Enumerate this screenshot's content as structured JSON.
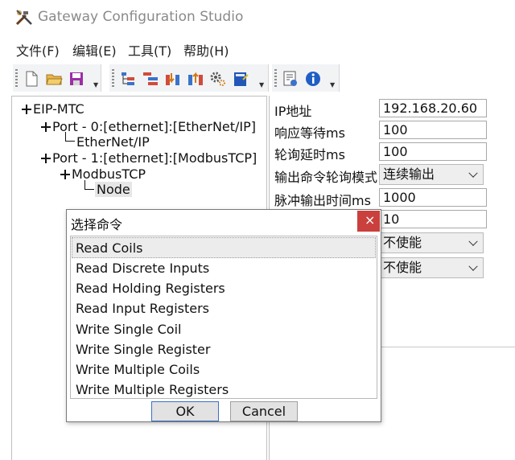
{
  "window": {
    "title": "Gateway Configuration Studio"
  },
  "menu": [
    "文件(F)",
    "编辑(E)",
    "工具(T)",
    "帮助(H)"
  ],
  "toolbar": {
    "groups": [
      [
        "new-file-icon",
        "open-folder-icon",
        "save-icon"
      ],
      [
        "tree-config-icon",
        "list-config-icon",
        "import-icon",
        "export-icon",
        "settings-gear-icon",
        "notebook-icon"
      ],
      [
        "document-settings-icon",
        "info-icon"
      ]
    ]
  },
  "tree": {
    "root": "EIP-MTC",
    "port0": "Port - 0:[ethernet]:[EtherNet/IP]",
    "port0_child": "EtherNet/IP",
    "port1": "Port - 1:[ethernet]:[ModbusTCP]",
    "port1_child": "ModbusTCP",
    "node": "Node"
  },
  "properties": {
    "ip_label": "IP地址",
    "ip_value": "192.168.20.60",
    "timeout_label": "响应等待ms",
    "timeout_value": "100",
    "poll_label": "轮询延时ms",
    "poll_value": "100",
    "mode_label": "输出命令轮询模式",
    "mode_value": "连续输出",
    "pulse_label": "脉冲输出时间ms",
    "pulse_value": "1000",
    "row6_value": "10",
    "row7_value": "不使能",
    "row8_value": "不使能"
  },
  "dialog": {
    "title": "选择命令",
    "close": "×",
    "commands": [
      "Read Coils",
      "Read Discrete Inputs",
      "Read Holding Registers",
      "Read Input Registers",
      "Write Single Coil",
      "Write Single Register",
      "Write Multiple Coils",
      "Write Multiple Registers"
    ],
    "ok": "OK",
    "cancel": "Cancel"
  },
  "colors": {
    "close_red": "#c9403d",
    "toolbar_bg": "#f2f3f5"
  }
}
